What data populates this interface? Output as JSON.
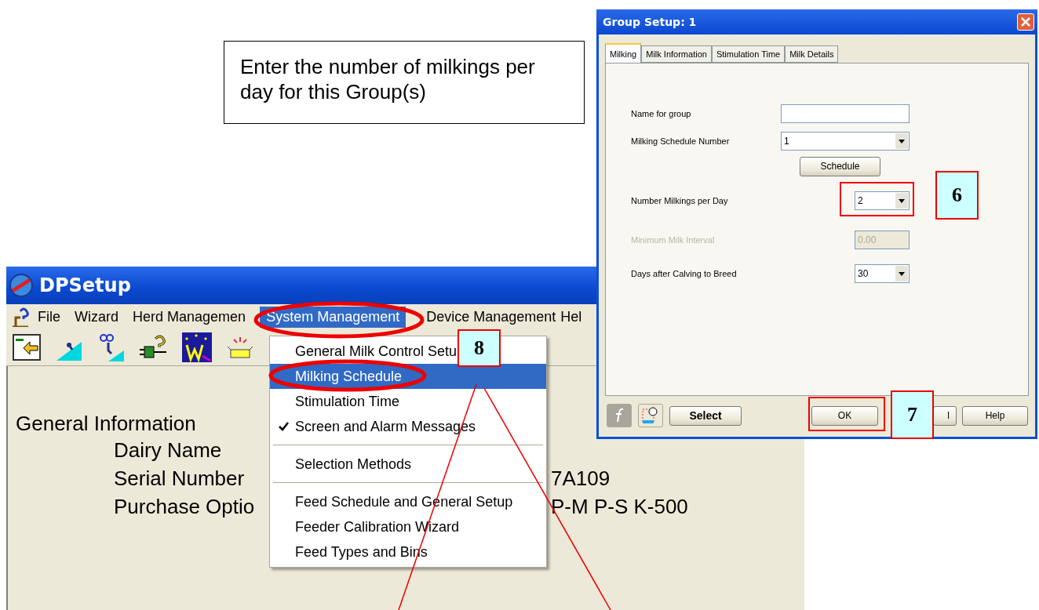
{
  "callout": {
    "text": "Enter the number of milkings per day for this Group(s)"
  },
  "main_window": {
    "title": "DPSetup",
    "menu": [
      {
        "label": "File",
        "selected": false
      },
      {
        "label": "Wizard",
        "selected": false
      },
      {
        "label": "Herd Managemen",
        "selected": false
      },
      {
        "label": "System Management",
        "selected": true
      },
      {
        "label": "Device Management",
        "selected": false
      },
      {
        "label": "Hel",
        "selected": false
      }
    ],
    "heading": "General Information",
    "rows": [
      {
        "label": "Dairy Name"
      },
      {
        "label": "Serial Number",
        "value": "7A109"
      },
      {
        "label": "Purchase Optio",
        "value": "P-M  P-S  K-500"
      }
    ]
  },
  "dropdown": {
    "items": [
      {
        "kind": "item",
        "label": "General Milk Control Setu",
        "selected": false,
        "checked": false
      },
      {
        "kind": "item",
        "label": "Milking Schedule",
        "selected": true,
        "checked": false
      },
      {
        "kind": "item",
        "label": "Stimulation Time",
        "selected": false,
        "checked": false
      },
      {
        "kind": "item",
        "label": "Screen and Alarm Messages",
        "selected": false,
        "checked": true
      },
      {
        "kind": "separator"
      },
      {
        "kind": "item",
        "label": "Selection Methods",
        "selected": false,
        "checked": false
      },
      {
        "kind": "separator"
      },
      {
        "kind": "item",
        "label": "Feed Schedule and General Setup",
        "selected": false,
        "checked": false
      },
      {
        "kind": "item",
        "label": "Feeder Calibration Wizard",
        "selected": false,
        "checked": false
      },
      {
        "kind": "item",
        "label": "Feed Types and Bins",
        "selected": false,
        "checked": false
      }
    ]
  },
  "dialog": {
    "title": "Group Setup: 1",
    "tabs": [
      {
        "label": "Milking",
        "selected": true
      },
      {
        "label": "Milk Information",
        "selected": false
      },
      {
        "label": "Stimulation Time",
        "selected": false
      },
      {
        "label": "Milk Details",
        "selected": false
      }
    ],
    "fields": [
      {
        "kind": "text",
        "label": "Name for group",
        "disabled": false
      },
      {
        "kind": "combo",
        "label": "Milking Schedule Number",
        "value": "1",
        "disabled": false
      },
      {
        "kind": "button",
        "label": "Schedule"
      },
      {
        "kind": "combo",
        "label": "Number Milkings per Day",
        "value": "2",
        "disabled": false
      },
      {
        "kind": "text",
        "label": "Minimum Milk Interval",
        "value": "0.00",
        "disabled": true
      },
      {
        "kind": "combo",
        "label": "Days after Calving to Breed",
        "value": "30",
        "disabled": false
      }
    ],
    "buttons": [
      {
        "label": "Select"
      },
      {
        "label": "OK"
      },
      {
        "label": "l"
      },
      {
        "label": "Help"
      }
    ]
  },
  "steps": [
    {
      "label": "8"
    },
    {
      "label": "6"
    },
    {
      "label": "7"
    }
  ]
}
